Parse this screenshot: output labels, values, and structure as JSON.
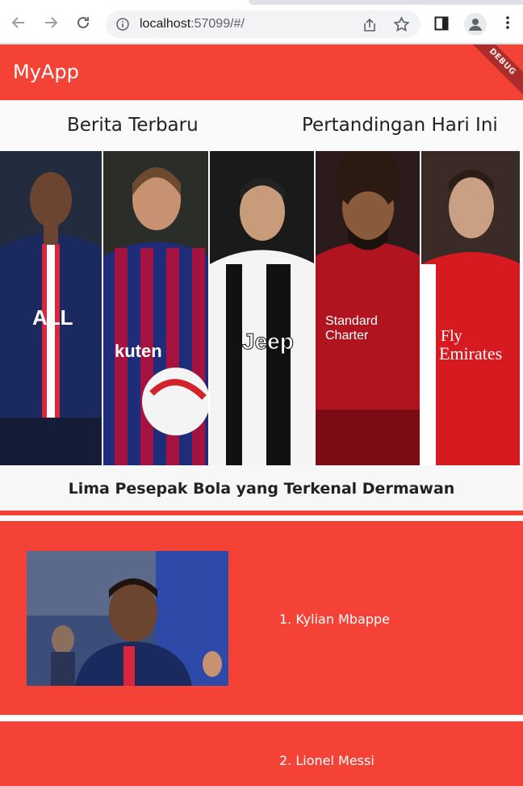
{
  "browser": {
    "url_host": "localhost",
    "url_rest": ":57099/#/"
  },
  "appbar": {
    "title": "MyApp",
    "debug_label": "DEBUG"
  },
  "tabs": [
    {
      "label": "Berita Terbaru"
    },
    {
      "label": "Pertandingan Hari Ini"
    }
  ],
  "hero": {
    "panels": [
      {
        "name": "mbappe-photo",
        "jersey": "#1b2a5e",
        "accent": "#d7263d"
      },
      {
        "name": "messi-photo",
        "jersey": "#1e2c7a",
        "accent": "#a4123f"
      },
      {
        "name": "ronaldo-photo",
        "jersey": "#f4f4f4",
        "accent": "#111111"
      },
      {
        "name": "salah-photo",
        "jersey": "#b0141e",
        "accent": "#7d0c14"
      },
      {
        "name": "ozil-photo",
        "jersey": "#d71920",
        "accent": "#ffffff"
      }
    ]
  },
  "headline": "Lima Pesepak Bola yang Terkenal Dermawan",
  "players": [
    {
      "label": "1. Kylian Mbappe"
    },
    {
      "label": "2. Lionel Messi"
    }
  ],
  "colors": {
    "primary": "#f44336",
    "tab_bg": "#fafafa"
  }
}
